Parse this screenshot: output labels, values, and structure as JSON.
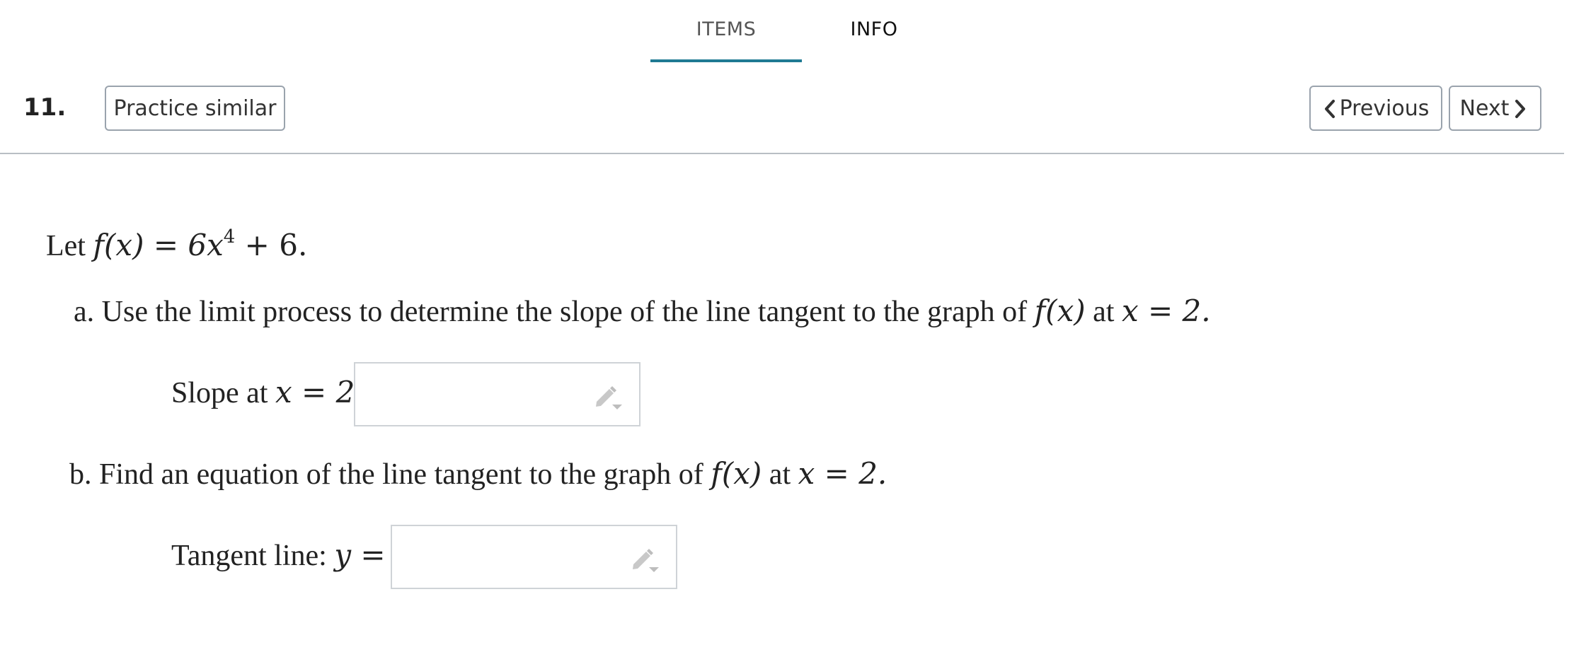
{
  "tabs": {
    "items_label": "ITEMS",
    "info_label": "INFO",
    "active": "ITEMS",
    "accent_color": "#1f7a93"
  },
  "toolbar": {
    "question_number": "11.",
    "practice_label": "Practice similar",
    "previous_label": "Previous",
    "next_label": "Next"
  },
  "problem": {
    "intro_prefix": "Let ",
    "function_def": "f(x) = 6x",
    "exponent": "4",
    "function_tail": " + 6.",
    "part_a": {
      "marker": "a.",
      "text": "Use the limit process to determine the slope of the line tangent to the graph of",
      "math_fx": "f(x)",
      "at": " at ",
      "math_x": "x = 2.",
      "answer_label_text": "Slope at ",
      "answer_label_math": "x = 2:",
      "answer_value": ""
    },
    "part_b": {
      "marker": "b.",
      "text": "Find an equation of the line tangent to the graph of",
      "math_fx": "f(x)",
      "at": " at ",
      "math_x": "x = 2.",
      "answer_label_text": "Tangent line: ",
      "answer_label_math": "y =",
      "answer_value": ""
    }
  }
}
